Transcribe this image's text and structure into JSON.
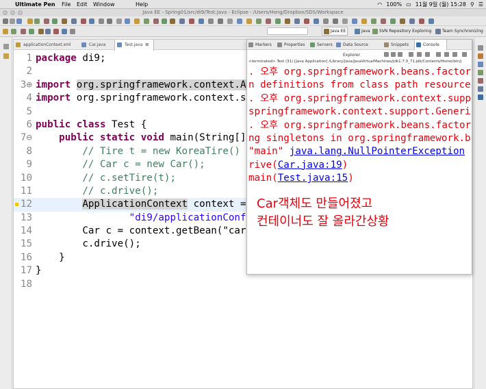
{
  "menubar": {
    "apple": "",
    "app_name": "Ultimate Pen",
    "items": [
      "File",
      "Edit",
      "Window",
      "Help"
    ],
    "battery": "100%",
    "datetime": "11월 9일 (월)  15:28"
  },
  "window": {
    "title": "Java EE - Spring01/src/di9/Test.java - Eclipse - /Users/Hong/Dropbox/SDS/Workspace"
  },
  "perspectives": [
    {
      "label": "Java EE",
      "color": "#8a6d3b",
      "active": true
    },
    {
      "label": "Java",
      "color": "#5b7fa8",
      "active": false
    },
    {
      "label": "SVN Repository Exploring",
      "color": "#7a9a6a",
      "active": false
    },
    {
      "label": "Team Synchronizing",
      "color": "#6a7a9a",
      "active": false
    }
  ],
  "editor": {
    "tabs": [
      {
        "label": "applicationContext.xml",
        "icon": "xml-file-icon",
        "color": "#c59a3a",
        "active": false
      },
      {
        "label": "Car.java",
        "icon": "java-file-icon",
        "color": "#6b8bbf",
        "active": false
      },
      {
        "label": "Test.java",
        "icon": "java-file-icon",
        "color": "#6b8bbf",
        "active": true
      }
    ],
    "close_glyph": "⊠",
    "lines": [
      {
        "num": "1",
        "tokens": [
          {
            "t": "package",
            "c": "kw"
          },
          {
            "t": " di9;",
            "c": ""
          }
        ]
      },
      {
        "num": "2",
        "tokens": []
      },
      {
        "num": "3⊕",
        "tokens": [
          {
            "t": "import",
            "c": "kw"
          },
          {
            "t": " ",
            "c": ""
          },
          {
            "t": "org.springframework.context.A",
            "c": "hlword"
          }
        ]
      },
      {
        "num": "4",
        "tokens": [
          {
            "t": "import",
            "c": "kw"
          },
          {
            "t": " org.springframework.context.s",
            "c": ""
          }
        ]
      },
      {
        "num": "5",
        "tokens": []
      },
      {
        "num": "6",
        "tokens": [
          {
            "t": "public",
            "c": "kw"
          },
          {
            "t": " ",
            "c": ""
          },
          {
            "t": "class",
            "c": "kw"
          },
          {
            "t": " Test {",
            "c": ""
          }
        ]
      },
      {
        "num": "7⊖",
        "tokens": [
          {
            "t": "    ",
            "c": ""
          },
          {
            "t": "public",
            "c": "kw"
          },
          {
            "t": " ",
            "c": ""
          },
          {
            "t": "static",
            "c": "kw"
          },
          {
            "t": " ",
            "c": ""
          },
          {
            "t": "void",
            "c": "kw"
          },
          {
            "t": " main(String[]",
            "c": ""
          }
        ]
      },
      {
        "num": "8",
        "tokens": [
          {
            "t": "        // Tire t = new KoreaTire()",
            "c": "cm"
          }
        ]
      },
      {
        "num": "9",
        "tokens": [
          {
            "t": "        // Car c = new Car();",
            "c": "cm"
          }
        ]
      },
      {
        "num": "10",
        "tokens": [
          {
            "t": "        // c.setTire(t);",
            "c": "cm"
          }
        ]
      },
      {
        "num": "11",
        "tokens": [
          {
            "t": "        // c.drive();",
            "c": "cm"
          }
        ]
      },
      {
        "num": "12",
        "tokens": [
          {
            "t": "        ",
            "c": ""
          },
          {
            "t": "ApplicationContext",
            "c": "hlword"
          },
          {
            "t": " context =",
            "c": ""
          }
        ],
        "current": true
      },
      {
        "num": "13",
        "tokens": [
          {
            "t": "                ",
            "c": ""
          },
          {
            "t": "\"di9/applicationConf",
            "c": "st"
          }
        ]
      },
      {
        "num": "14",
        "tokens": [
          {
            "t": "        Car c = context.getBean(\"car",
            "c": ""
          }
        ]
      },
      {
        "num": "15",
        "tokens": [
          {
            "t": "        c.drive();",
            "c": ""
          }
        ]
      },
      {
        "num": "16",
        "tokens": [
          {
            "t": "    }",
            "c": ""
          }
        ]
      },
      {
        "num": "17",
        "tokens": [
          {
            "t": "}",
            "c": ""
          }
        ]
      },
      {
        "num": "18",
        "tokens": []
      }
    ]
  },
  "console": {
    "tabs": [
      {
        "label": "Markers",
        "color": "#8a8a8a"
      },
      {
        "label": "Properties",
        "color": "#8a8a8a"
      },
      {
        "label": "Servers",
        "color": "#6a9a6a"
      },
      {
        "label": "Data Source Explorer",
        "color": "#6b8bbf"
      },
      {
        "label": "Snippets",
        "color": "#9a8a6a"
      },
      {
        "label": "Console",
        "color": "#3a6ea5",
        "active": true
      }
    ],
    "status": "<terminated> Test (31) [Java Application] /Library/Java/JavaVirtualMachines/jdk1.7.0_71.jdk/Contents/Home/bin/j",
    "lines": [
      [
        {
          "t": ". 오후 org.springframework.beans.factory",
          "c": ""
        }
      ],
      [
        {
          "t": "n definitions from class path resource",
          "c": ""
        }
      ],
      [
        {
          "t": ". 오후 org.springframework.context.suppo",
          "c": ""
        }
      ],
      [
        {
          "t": "springframework.context.support.Generi",
          "c": ""
        }
      ],
      [
        {
          "t": ". 오후 org.springframework.beans.factory",
          "c": ""
        }
      ],
      [
        {
          "t": "ng singletons in org.springframework.b",
          "c": ""
        }
      ],
      [
        {
          "t": "\"main\" ",
          "c": ""
        },
        {
          "t": "java.lang.NullPointerException",
          "c": "link"
        }
      ],
      [
        {
          "t": "rive(",
          "c": ""
        },
        {
          "t": "Car.java:19",
          "c": "link"
        },
        {
          "t": ")",
          "c": ""
        }
      ],
      [
        {
          "t": "main(",
          "c": ""
        },
        {
          "t": "Test.java:15",
          "c": "link"
        },
        {
          "t": ")",
          "c": ""
        }
      ]
    ],
    "annotation": [
      "Car객체도 만들어졌고",
      "컨테이너도 잘 올라간상황"
    ]
  }
}
